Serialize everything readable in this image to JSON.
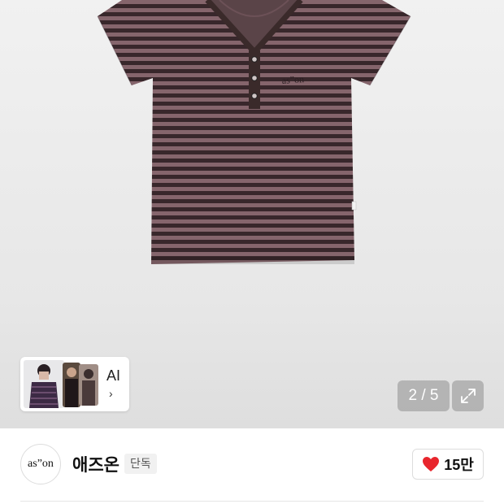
{
  "gallery": {
    "product": "striped henley t-shirt",
    "chest_logo_text": "as”on",
    "counter_text": "2 / 5",
    "expand_icon": "expand-icon"
  },
  "ai_card": {
    "label": "AI",
    "chevron": "›"
  },
  "brand": {
    "logo_text": "as”on",
    "name": "애즈온",
    "badge": "단독"
  },
  "like": {
    "icon": "heart-icon",
    "count": "15만",
    "color": "#e8262d"
  },
  "colors": {
    "stripe_mauve": "#8d6b72",
    "stripe_dark": "#3c2a2e",
    "trim": "#3a2a2a"
  }
}
